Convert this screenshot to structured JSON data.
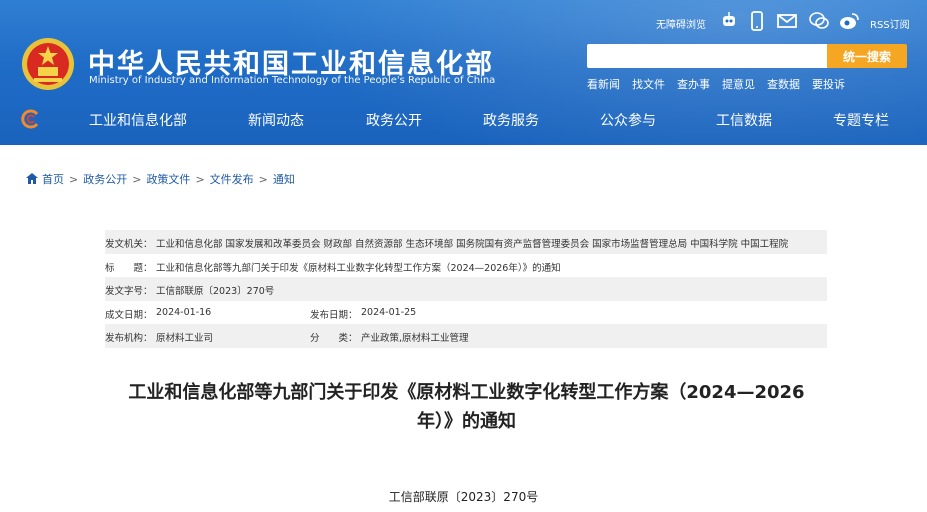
{
  "header": {
    "title": "中华人民共和国工业和信息化部",
    "subtitle": "Ministry of Industry and Information Technology of the People's Republic of China",
    "accessibility_label": "无障碍浏览",
    "rss_label": "RSS订阅",
    "search": {
      "placeholder": "",
      "button_label": "统一搜索"
    },
    "quick_links": [
      "看新闻",
      "找文件",
      "查办事",
      "提意见",
      "查数据",
      "要投诉"
    ]
  },
  "nav": {
    "items": [
      "工业和信息化部",
      "新闻动态",
      "政务公开",
      "政务服务",
      "公众参与",
      "工信数据",
      "专题专栏"
    ]
  },
  "breadcrumb": [
    "首页",
    "政务公开",
    "政策文件",
    "文件发布",
    "通知"
  ],
  "meta": {
    "issuer_label": "发文机关：",
    "issuer_value": "工业和信息化部 国家发展和改革委员会 财政部 自然资源部 生态环境部 国务院国有资产监督管理委员会 国家市场监督管理总局 中国科学院 中国工程院",
    "title_label": "标　　题：",
    "title_value": "工业和信息化部等九部门关于印发《原材料工业数字化转型工作方案（2024—2026年）》的通知",
    "docno_label": "发文字号：",
    "docno_value": "工信部联原〔2023〕270号",
    "written_label": "成文日期：",
    "written_value": "2024-01-16",
    "published_label": "发布日期：",
    "published_value": "2024-01-25",
    "org_label": "发布机构：",
    "org_value": "原材料工业司",
    "category_label": "分　　类：",
    "category_value": "产业政策,原材料工业管理"
  },
  "document": {
    "title_line1": "工业和信息化部等九部门关于印发《原材料工业数字化转型工作方案（2024—2026",
    "title_line2": "年）》的通知",
    "number": "工信部联原〔2023〕270号"
  },
  "colors": {
    "header_blue": "#1f6cc6",
    "search_button": "#f5a623",
    "link_blue": "#1f5aa6",
    "row_shade": "#f0f0f0"
  }
}
